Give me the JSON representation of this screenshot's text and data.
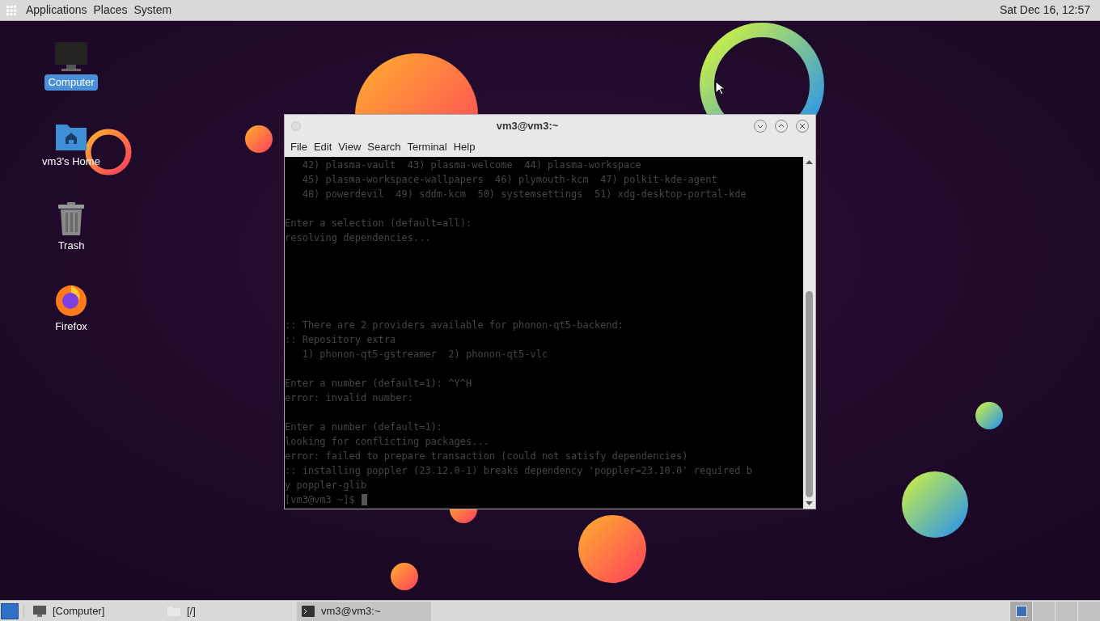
{
  "top_panel": {
    "menus": [
      "Applications",
      "Places",
      "System"
    ],
    "clock": "Sat Dec 16, 12:57"
  },
  "desktop_icons": [
    {
      "kind": "computer",
      "label": "Computer",
      "selected": true
    },
    {
      "kind": "home",
      "label": "vm3's Home",
      "selected": false
    },
    {
      "kind": "trash",
      "label": "Trash",
      "selected": false
    },
    {
      "kind": "firefox",
      "label": "Firefox",
      "selected": false
    }
  ],
  "terminal": {
    "title": "vm3@vm3:~",
    "menus": [
      "File",
      "Edit",
      "View",
      "Search",
      "Terminal",
      "Help"
    ],
    "blocks": [
      {
        "lines": [
          "   42) plasma-vault  43) plasma-welcome  44) plasma-workspace",
          "   45) plasma-workspace-wallpapers  46) plymouth-kcm  47) polkit-kde-agent",
          "   48) powerdevil  49) sddm-kcm  50) systemsettings  51) xdg-desktop-portal-kde"
        ]
      },
      {
        "lines": [
          "Enter a selection (default=all):",
          "resolving dependencies..."
        ]
      },
      {
        "lines": [
          ":: There are 2 providers available for phonon-qt5-backend:",
          ":: Repository extra",
          "   1) phonon-qt5-gstreamer  2) phonon-qt5-vlc"
        ]
      },
      {
        "lines": [
          "Enter a number (default=1): ^Y^H",
          "error: invalid number:"
        ]
      },
      {
        "lines": [
          "Enter a number (default=1):",
          "looking for conflicting packages...",
          "error: failed to prepare transaction (could not satisfy dependencies)",
          ":: installing poppler (23.12.0-1) breaks dependency 'poppler=23.10.0' required b",
          "y poppler-glib"
        ]
      }
    ],
    "prompt": "[vm3@vm3 ~]$"
  },
  "taskbar": {
    "tasks": [
      {
        "kind": "computer",
        "label": "[Computer]",
        "selected": false
      },
      {
        "kind": "folder",
        "label": "[/]",
        "selected": false
      },
      {
        "kind": "terminal",
        "label": "vm3@vm3:~",
        "selected": true
      }
    ],
    "workspaces": [
      {
        "selected": true
      },
      {
        "selected": false
      },
      {
        "selected": false
      },
      {
        "selected": false
      }
    ]
  }
}
